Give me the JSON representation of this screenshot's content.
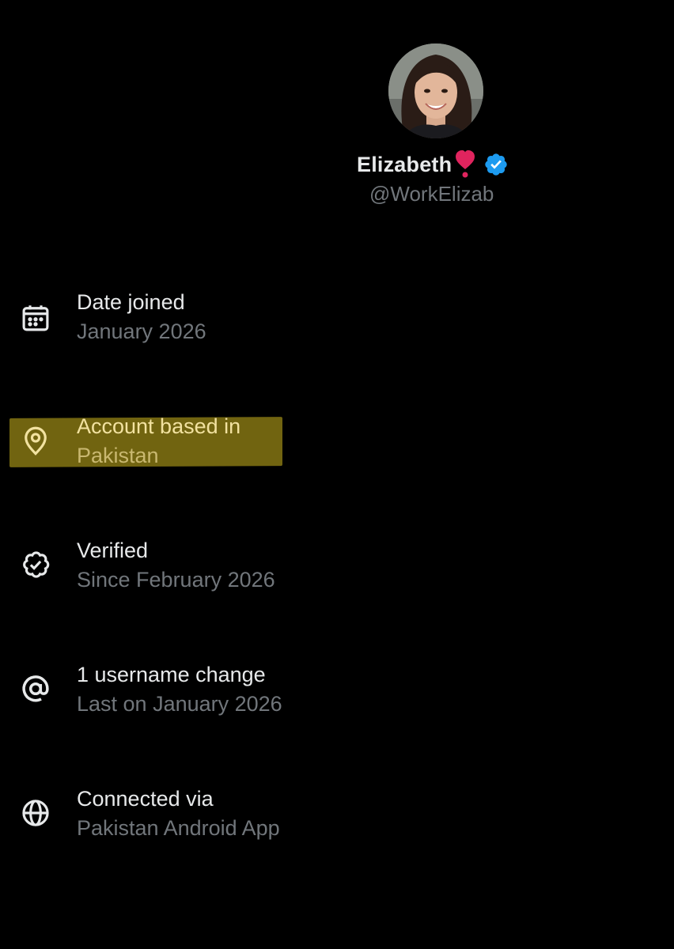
{
  "profile": {
    "display_name": "Elizabeth",
    "handle": "@WorkElizab",
    "heart_icon": "heart-exclamation-icon",
    "verified_icon": "verified-badge-icon",
    "heart_color": "#e0245e",
    "verified_color": "#1d9bf0"
  },
  "info": [
    {
      "icon": "calendar-icon",
      "title": "Date joined",
      "value": "January 2026"
    },
    {
      "icon": "location-pin-icon",
      "title": "Account based in",
      "value": "Pakistan",
      "highlighted": true
    },
    {
      "icon": "verified-icon",
      "title": "Verified",
      "value": "Since February 2026"
    },
    {
      "icon": "at-sign-icon",
      "title": "1 username change",
      "value": "Last on January 2026"
    },
    {
      "icon": "globe-icon",
      "title": "Connected via",
      "value": "Pakistan Android App"
    }
  ],
  "colors": {
    "background": "#000000",
    "primary_text": "#e7e9ea",
    "secondary_text": "#71767b",
    "highlight": "#8a7a14"
  }
}
